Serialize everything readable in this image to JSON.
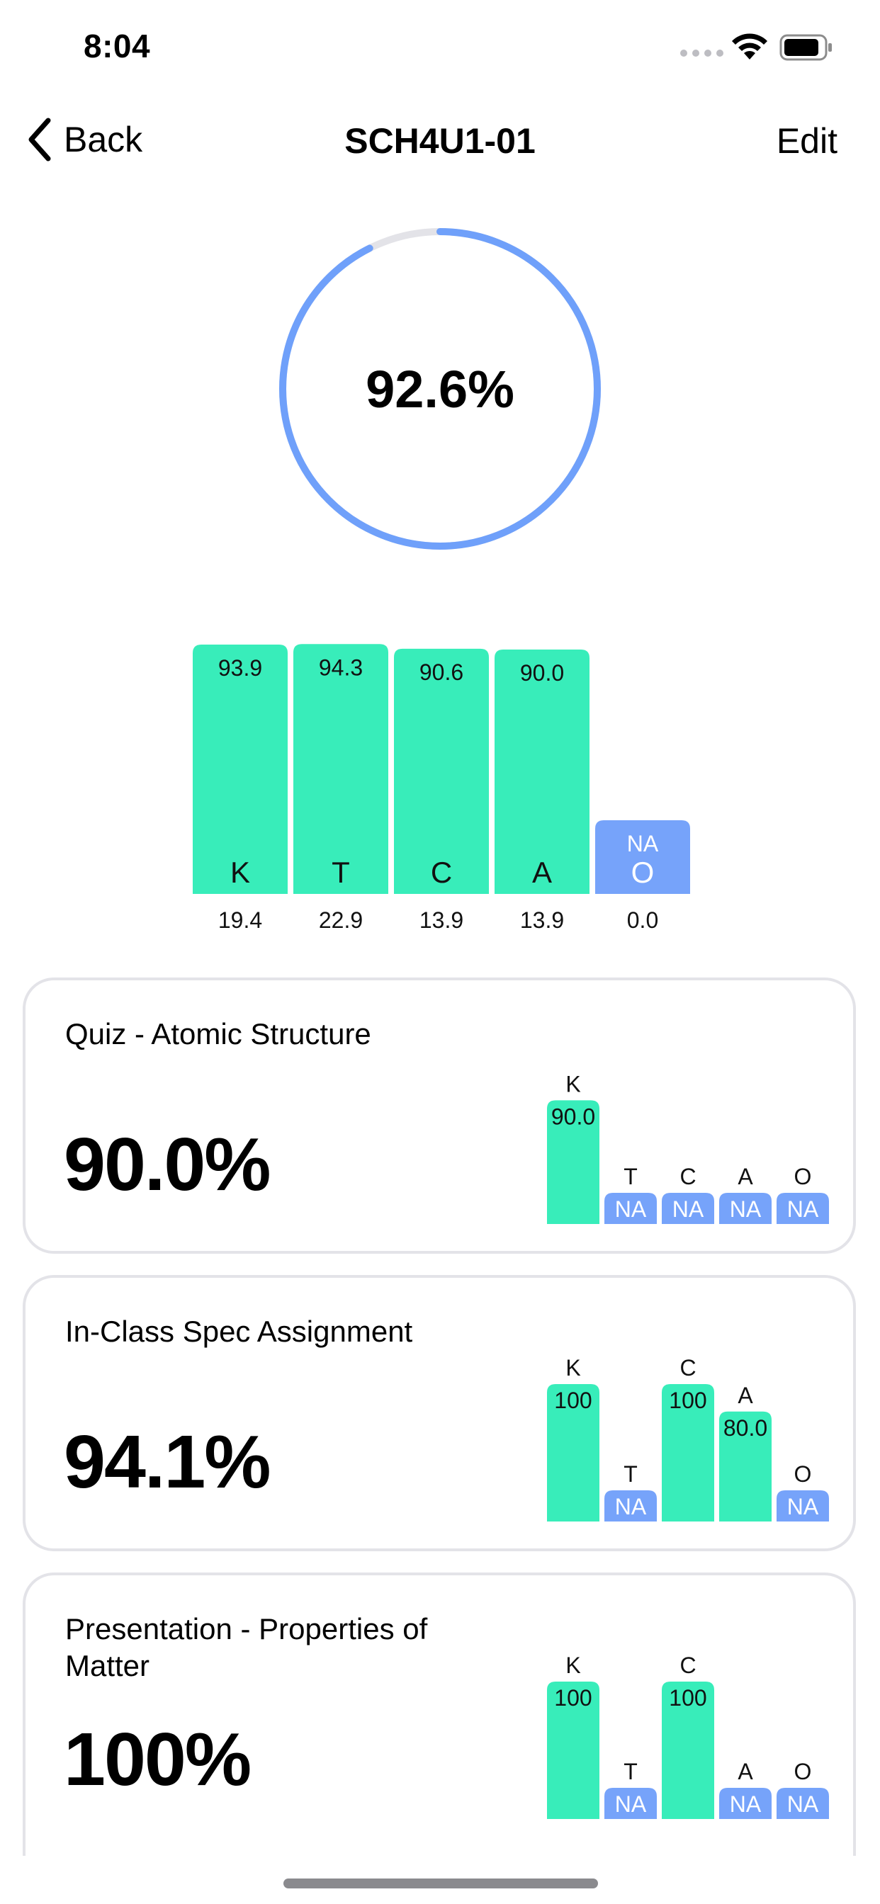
{
  "status_bar": {
    "time": "8:04"
  },
  "nav": {
    "back_label": "Back",
    "title": "SCH4U1-01",
    "edit_label": "Edit"
  },
  "summary": {
    "overall_label": "92.6%",
    "overall_fraction": 0.926
  },
  "colors": {
    "green": "#38EDBA",
    "blue": "#76A3FA",
    "ring_track": "#E3E3E8",
    "ring_accent": "#6FA0FA"
  },
  "chart_data": {
    "type": "bar",
    "categories": [
      "K",
      "T",
      "C",
      "A",
      "O"
    ],
    "value_labels": [
      "93.9",
      "94.3",
      "90.6",
      "90.0",
      "NA"
    ],
    "values": [
      93.9,
      94.3,
      90.6,
      90.0,
      null
    ],
    "weights": [
      "19.4",
      "22.9",
      "13.9",
      "13.9",
      "0.0"
    ],
    "ylim": [
      0,
      100
    ]
  },
  "assessments": [
    {
      "title": "Quiz - Atomic Structure",
      "score": "90.0%",
      "categories": [
        "K",
        "T",
        "C",
        "A",
        "O"
      ],
      "values": [
        90.0,
        null,
        null,
        null,
        null
      ],
      "labels": [
        "90.0",
        "NA",
        "NA",
        "NA",
        "NA"
      ]
    },
    {
      "title": "In-Class Spec Assignment",
      "score": "94.1%",
      "categories": [
        "K",
        "T",
        "C",
        "A",
        "O"
      ],
      "values": [
        100,
        null,
        100,
        80.0,
        null
      ],
      "labels": [
        "100",
        "NA",
        "100",
        "80.0",
        "NA"
      ]
    },
    {
      "title": "Presentation - Properties of Matter",
      "score": "100%",
      "categories": [
        "K",
        "T",
        "C",
        "A",
        "O"
      ],
      "values": [
        100,
        null,
        100,
        null,
        null
      ],
      "labels": [
        "100",
        "NA",
        "100",
        "NA",
        "NA"
      ]
    }
  ]
}
